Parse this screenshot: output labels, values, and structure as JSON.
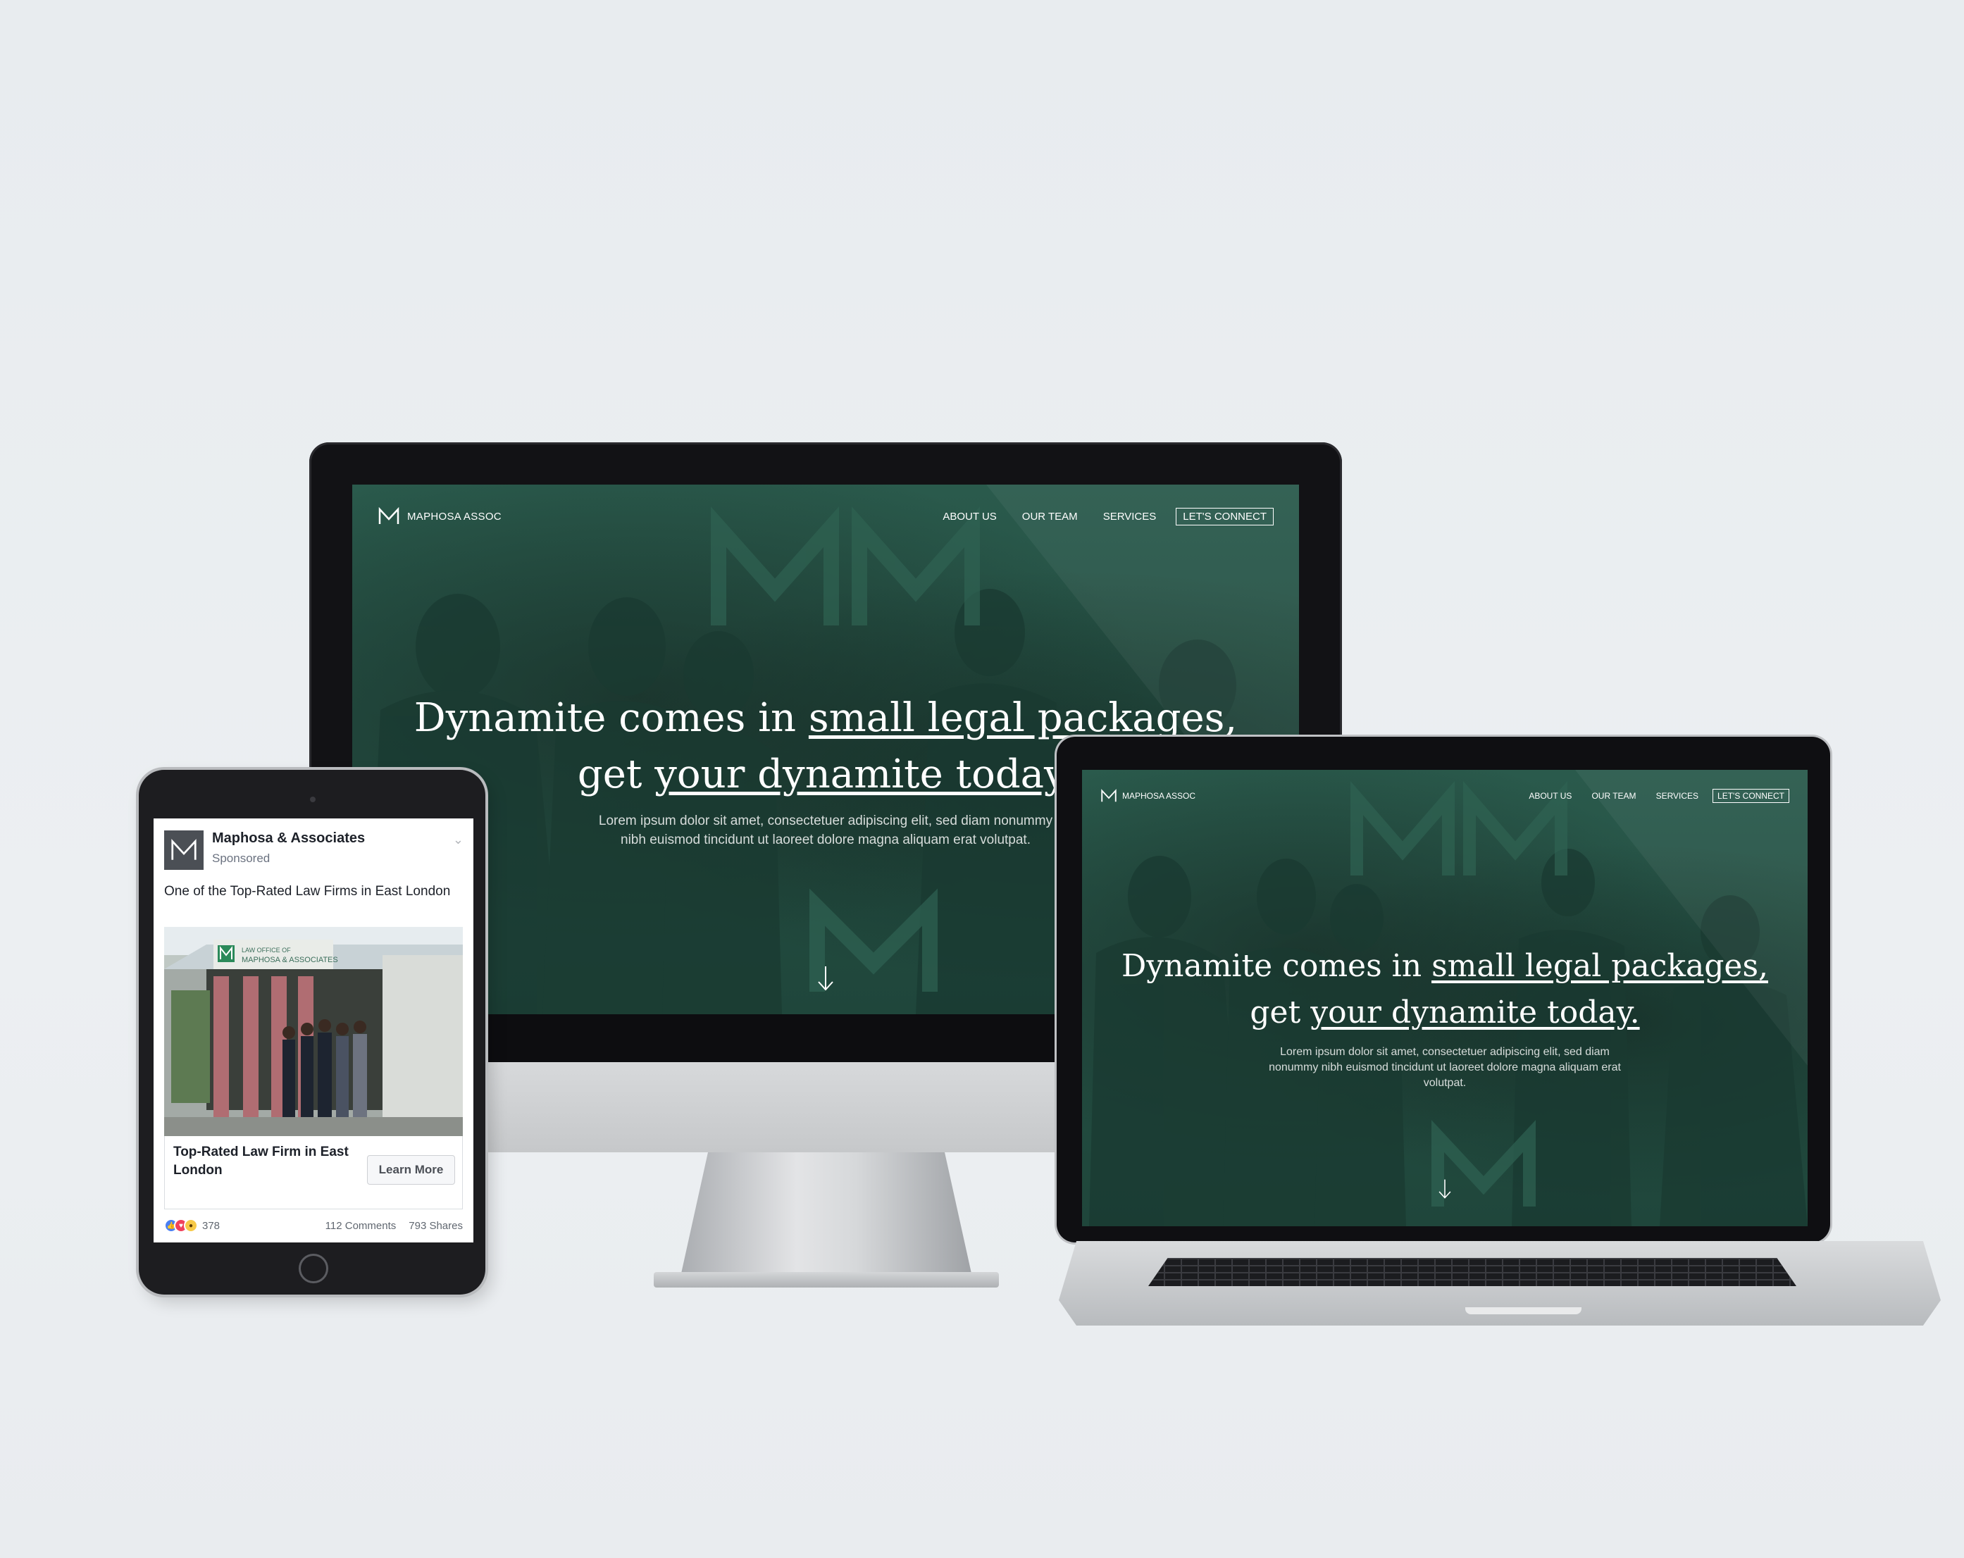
{
  "website": {
    "brand": "MAPHOSA ASSOC",
    "nav": [
      "ABOUT US",
      "OUR TEAM",
      "SERVICES"
    ],
    "cta": "LET'S CONNECT",
    "hero_line1_plain": "Dynamite comes in ",
    "hero_line1_underlined": "small legal packages,",
    "hero_line2_plain": "get ",
    "hero_line2_underlined": "your dynamite today.",
    "lorem": "Lorem ipsum dolor sit amet, consectetuer adipiscing elit, sed diam nonummy nibh euismod tincidunt ut laoreet dolore magna aliquam erat volutpat.",
    "scroll_icon": "down-arrow-icon"
  },
  "facebook_ad": {
    "page_name": "Maphosa & Associates",
    "sponsored": "Sponsored",
    "post_text": "One of the Top-Rated Law Firms in East London",
    "photo_sign_line1": "LAW OFFICE OF",
    "photo_sign_line2": "MAPHOSA & ASSOCIATES",
    "card_title": "Top-Rated Law Firm in East London",
    "cta_label": "Learn More",
    "reaction_count": "378",
    "comments": "112 Comments",
    "shares": "793 Shares",
    "reactions": [
      "like-icon",
      "love-icon",
      "wow-icon"
    ]
  },
  "colors": {
    "site_green": "#24503f",
    "background": "#e9ecef",
    "fb_like": "#4a7ff2",
    "fb_love": "#f0415b",
    "fb_wow": "#f7c948"
  }
}
